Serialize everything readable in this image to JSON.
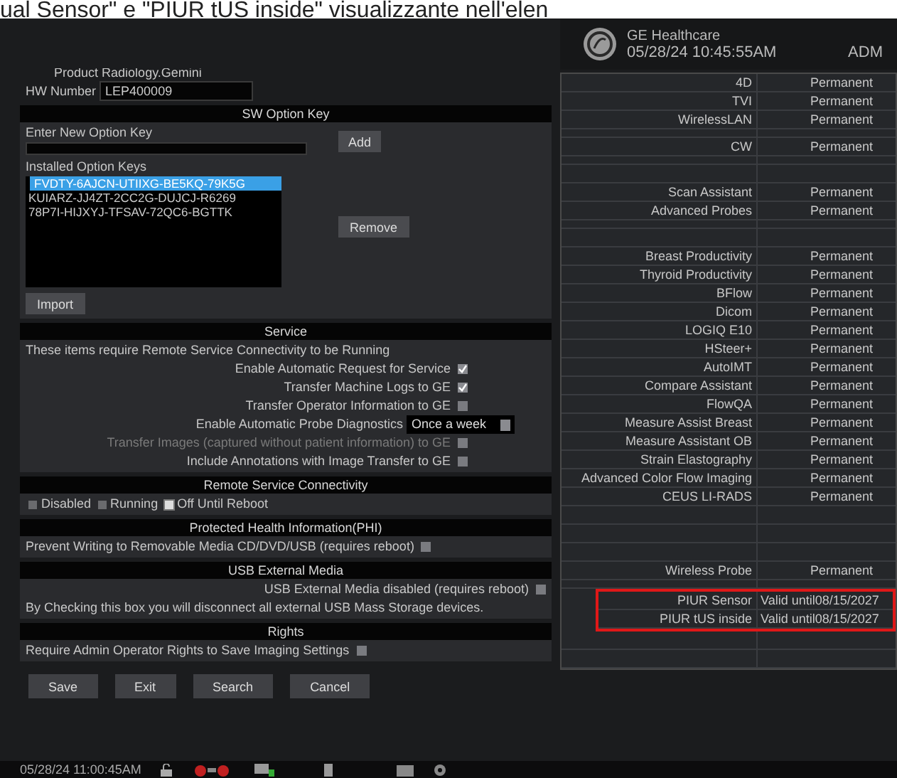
{
  "caption": "ual Sensor\" e \"PIUR tUS inside\" visualizzante nell'elen",
  "header": {
    "brand": "GE Healthcare",
    "datetime": "05/28/24 10:45:55AM",
    "user": "ADM"
  },
  "product": {
    "label": "Product",
    "value": "Radiology.Gemini"
  },
  "hw_number": {
    "label": "HW Number",
    "value": "LEP400009"
  },
  "sw_option_key": {
    "title": "SW Option Key",
    "enter_label": "Enter New Option Key",
    "add_button": "Add",
    "installed_label": "Installed Option Keys",
    "keys": [
      {
        "text": "FVDTY-6AJCN-UTIIXG-BE5KQ-79K5G",
        "selected": true
      },
      {
        "text": "KUIARZ-JJ4ZT-2CC2G-DUJCJ-R6269",
        "selected": false
      },
      {
        "text": "78P7I-HIJXYJ-TFSAV-72QC6-BGTTK",
        "selected": false
      }
    ],
    "remove_button": "Remove",
    "import_button": "Import"
  },
  "service": {
    "title": "Service",
    "note": "These items require Remote Service Connectivity to be Running",
    "items": [
      {
        "kind": "check",
        "label": "Enable Automatic Request for Service",
        "checked": true,
        "disabled": false
      },
      {
        "kind": "check",
        "label": "Transfer Machine Logs to GE",
        "checked": true,
        "disabled": false
      },
      {
        "kind": "check",
        "label": "Transfer Operator Information to GE",
        "checked": false,
        "disabled": false
      },
      {
        "kind": "select",
        "label": "Enable Automatic Probe Diagnostics",
        "value": "Once a week",
        "disabled": false
      },
      {
        "kind": "check",
        "label": "Transfer Images (captured without patient information) to GE",
        "checked": false,
        "disabled": true
      },
      {
        "kind": "check",
        "label": "Include Annotations with Image Transfer to GE",
        "checked": false,
        "disabled": false
      }
    ]
  },
  "remote_connectivity": {
    "title": "Remote Service Connectivity",
    "options": [
      {
        "label": "Disabled",
        "selected": false
      },
      {
        "label": "Running",
        "selected": false
      },
      {
        "label": "Off Until Reboot",
        "selected": true
      }
    ]
  },
  "phi": {
    "title": "Protected Health Information(PHI)",
    "label": "Prevent Writing to Removable Media CD/DVD/USB (requires reboot)",
    "checked": false
  },
  "usb": {
    "title": "USB External Media",
    "label": "USB External Media disabled (requires reboot)",
    "checked": false,
    "note": "By Checking this box you will disconnect all external USB Mass Storage devices."
  },
  "rights": {
    "title": "Rights",
    "label": "Require Admin Operator Rights to Save Imaging Settings",
    "checked": false
  },
  "buttons": [
    "Save",
    "Exit",
    "Search",
    "Cancel"
  ],
  "options": [
    {
      "kind": "option",
      "name": "4D",
      "status": "Permanent"
    },
    {
      "kind": "option",
      "name": "TVI",
      "status": "Permanent"
    },
    {
      "kind": "option",
      "name": "WirelessLAN",
      "status": "Permanent"
    },
    {
      "kind": "gap"
    },
    {
      "kind": "option",
      "name": "CW",
      "status": "Permanent"
    },
    {
      "kind": "gap"
    },
    {
      "kind": "blank"
    },
    {
      "kind": "option",
      "name": "Scan Assistant",
      "status": "Permanent"
    },
    {
      "kind": "option",
      "name": "Advanced Probes",
      "status": "Permanent"
    },
    {
      "kind": "gap"
    },
    {
      "kind": "blank"
    },
    {
      "kind": "option",
      "name": "Breast Productivity",
      "status": "Permanent"
    },
    {
      "kind": "option",
      "name": "Thyroid Productivity",
      "status": "Permanent"
    },
    {
      "kind": "option",
      "name": "BFlow",
      "status": "Permanent"
    },
    {
      "kind": "option",
      "name": "Dicom",
      "status": "Permanent"
    },
    {
      "kind": "option",
      "name": "LOGIQ E10",
      "status": "Permanent"
    },
    {
      "kind": "option",
      "name": "HSteer+",
      "status": "Permanent"
    },
    {
      "kind": "option",
      "name": "AutoIMT",
      "status": "Permanent"
    },
    {
      "kind": "option",
      "name": "Compare Assistant",
      "status": "Permanent"
    },
    {
      "kind": "option",
      "name": "FlowQA",
      "status": "Permanent"
    },
    {
      "kind": "option",
      "name": "Measure Assist Breast",
      "status": "Permanent"
    },
    {
      "kind": "option",
      "name": "Measure Assistant OB",
      "status": "Permanent"
    },
    {
      "kind": "option",
      "name": "Strain Elastography",
      "status": "Permanent"
    },
    {
      "kind": "option",
      "name": "Advanced Color Flow Imaging",
      "status": "Permanent"
    },
    {
      "kind": "option",
      "name": "CEUS LI-RADS",
      "status": "Permanent"
    },
    {
      "kind": "blank"
    },
    {
      "kind": "blank"
    },
    {
      "kind": "blank"
    },
    {
      "kind": "option",
      "name": "Wireless Probe",
      "status": "Permanent"
    },
    {
      "kind": "gap"
    }
  ],
  "highlighted_options": [
    {
      "name": "PIUR Sensor",
      "status": "Valid until08/15/2027"
    },
    {
      "name": "PIUR tUS inside",
      "status": "Valid until08/15/2027"
    }
  ],
  "trailing_rows": [
    {
      "kind": "blank"
    },
    {
      "kind": "blank"
    }
  ],
  "taskbar": {
    "datetime": "05/28/24 11:00:45AM"
  }
}
